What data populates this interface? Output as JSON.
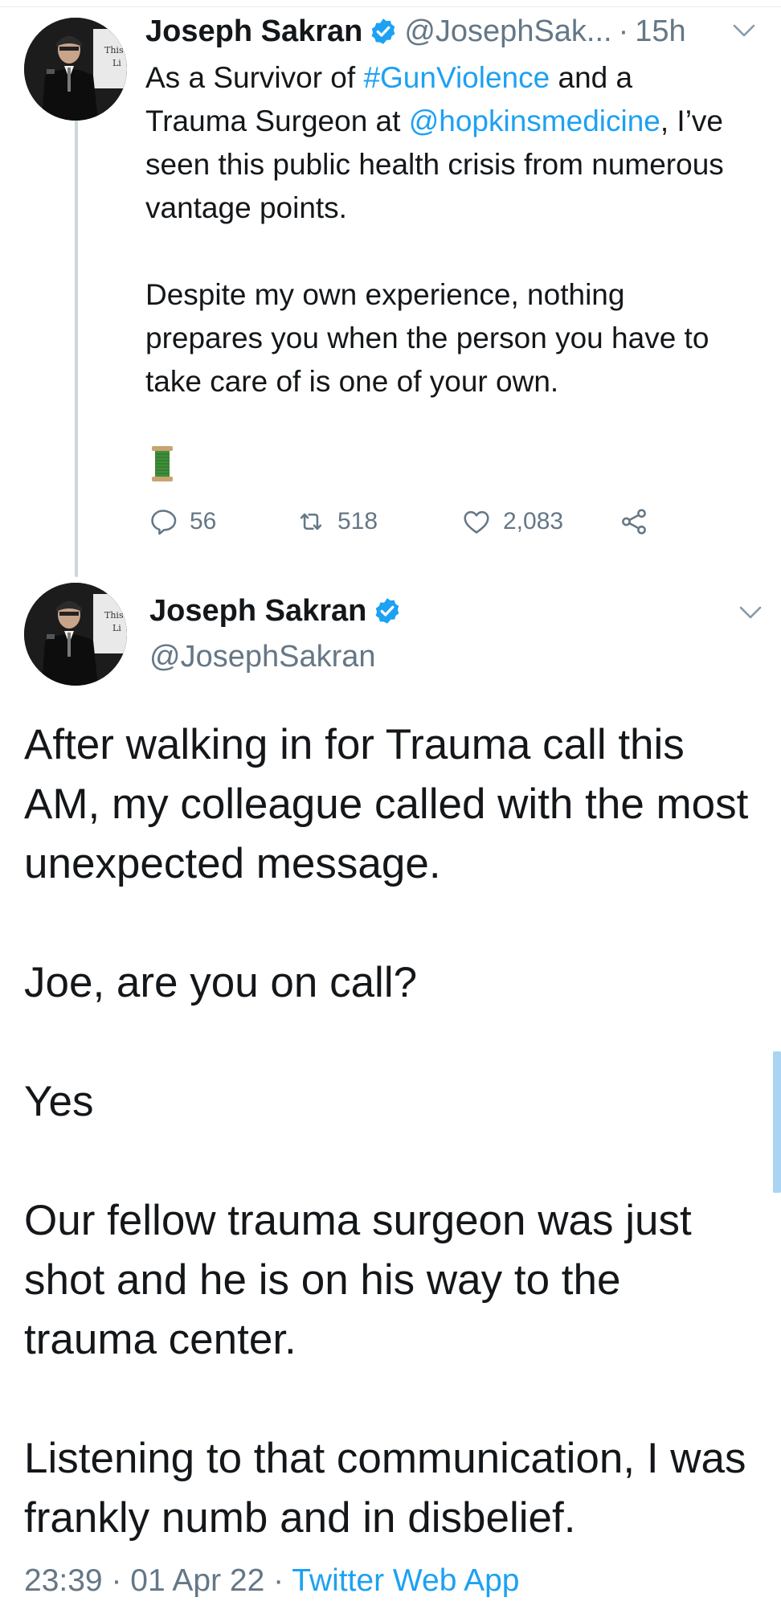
{
  "tweet1": {
    "display_name": "Joseph Sakran",
    "handle": "@JosephSak...",
    "separator": "·",
    "time": "15h",
    "body": {
      "p1_a": "As a Survivor of ",
      "p1_hashtag": "#GunViolence",
      "p1_b": " and a Trauma Surgeon at ",
      "p1_mention": "@hopkinsmedicine",
      "p1_c": ", I’ve seen this public health crisis from numerous vantage points.",
      "p2": "Despite my own experience, nothing prepares you when the person you have to take care of is one of your own.",
      "emoji": "spool-of-thread"
    },
    "counts": {
      "replies": "56",
      "retweets": "518",
      "likes": "2,083"
    }
  },
  "tweet2": {
    "display_name": "Joseph Sakran",
    "handle": "@JosephSakran",
    "paragraphs": [
      "After walking in for Trauma call this AM, my colleague called with the most unexpected message.",
      "Joe, are you on call?",
      "Yes",
      "Our fellow trauma surgeon was just shot and he is on his way to the trauma center.",
      "Listening to that communication, I was frankly numb and in disbelief."
    ],
    "time": "23:39",
    "separator": "·",
    "date": "01 Apr 22",
    "separator2": "·",
    "source": "Twitter Web App"
  },
  "icons": {
    "verified": "verified-badge-icon",
    "reply": "reply-icon",
    "retweet": "retweet-icon",
    "like": "heart-icon",
    "share": "share-icon",
    "more": "chevron-down-icon"
  },
  "colors": {
    "link": "#1da1f2",
    "secondary_text": "#657786",
    "primary_text": "#14171a",
    "verified": "#1da1f2",
    "thread_line": "#ccd6dd"
  }
}
